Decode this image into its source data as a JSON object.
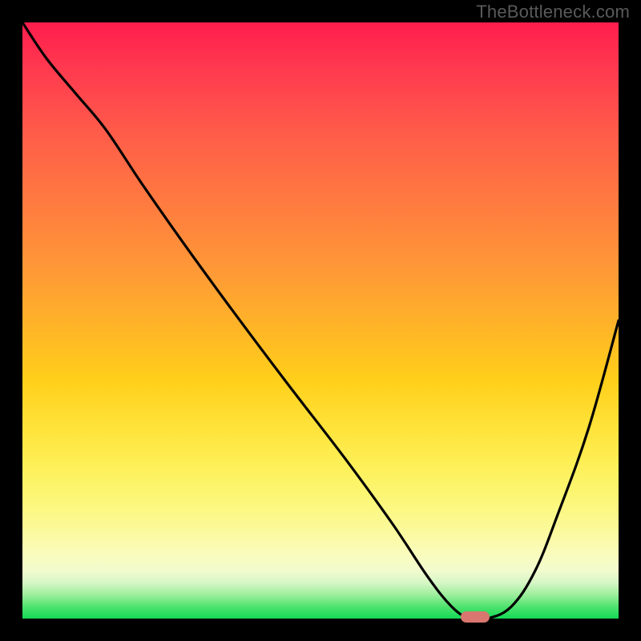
{
  "watermark": "TheBottleneck.com",
  "chart_data": {
    "type": "line",
    "title": "",
    "xlabel": "",
    "ylabel": "",
    "xlim": [
      0,
      100
    ],
    "ylim": [
      0,
      100
    ],
    "series": [
      {
        "name": "bottleneck-curve",
        "x": [
          0,
          4,
          9,
          14,
          20,
          27,
          35,
          44,
          54,
          62,
          68,
          72,
          75,
          78,
          82,
          86,
          90,
          95,
          100
        ],
        "values": [
          100,
          94,
          88,
          82,
          73,
          63,
          52,
          40,
          27,
          16,
          7,
          2,
          0,
          0,
          2,
          8,
          18,
          32,
          50
        ]
      }
    ],
    "marker": {
      "x": 76,
      "y": 0,
      "color": "#d8766f"
    },
    "background_gradient": {
      "top": "#ff1d4d",
      "mid": "#ffcf1a",
      "bottom": "#13d856"
    }
  }
}
